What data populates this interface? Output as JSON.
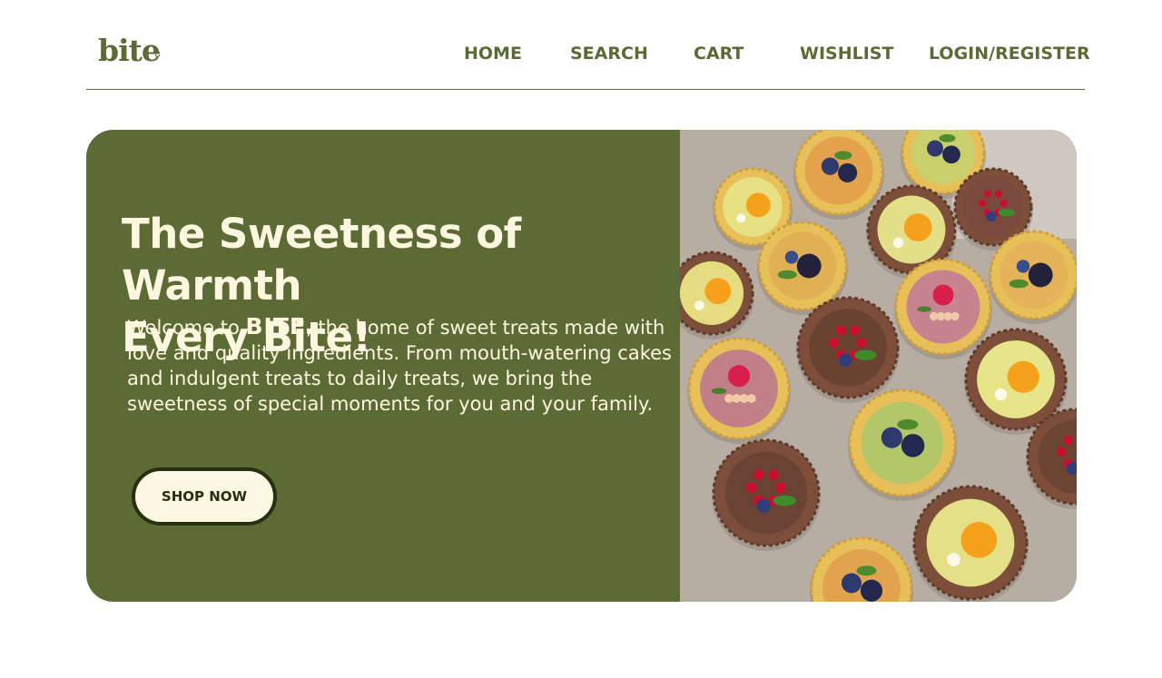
{
  "header": {
    "logo_text": "bite",
    "logo_dots": ".:",
    "nav": {
      "home": "HOME",
      "search": "SEARCH",
      "cart": "CART",
      "wishlist": "WISHLIST",
      "login": "LOGIN/REGISTER"
    }
  },
  "hero": {
    "headline_line1": "The Sweetness of Warmth",
    "headline_line2": "Every Bite!",
    "intro_prefix": "Welcome to ",
    "intro_brand": "BITE",
    "intro_rest": ", the home of sweet treats made with love and quality ingredients. From mouth-watering cakes and indulgent treats to daily treats, we bring the sweetness of special moments for you and your family.",
    "cta_label": "SHOP NOW",
    "image_subject": "tray of assorted fruit tarts"
  },
  "colors": {
    "brand_green": "#5c6a35",
    "cream": "#fdf7df",
    "button_border": "#253011"
  }
}
